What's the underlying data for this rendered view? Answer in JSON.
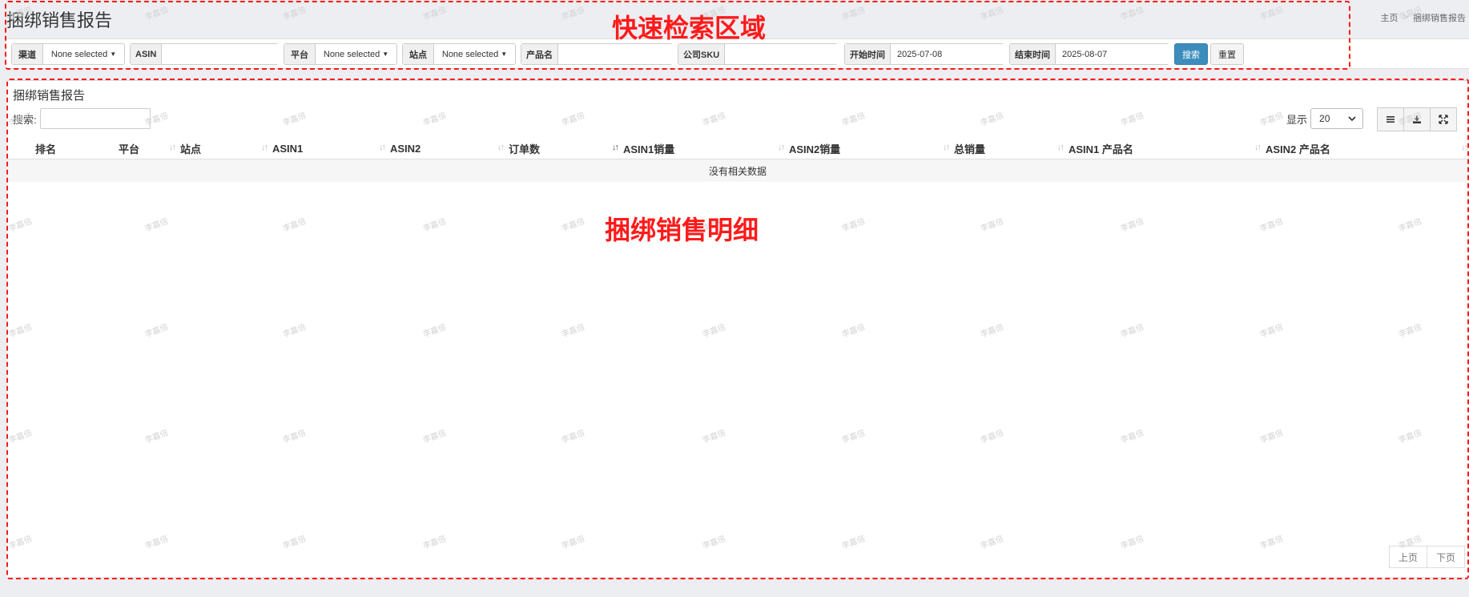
{
  "header": {
    "page_title": "捆绑销售报告",
    "breadcrumb": [
      "主页",
      "捆绑销售报告"
    ],
    "breadcrumb_sep": ">"
  },
  "filters": {
    "channel": {
      "label": "渠道",
      "value": "None selected"
    },
    "asin": {
      "label": "ASIN",
      "value": ""
    },
    "platform": {
      "label": "平台",
      "value": "None selected"
    },
    "site": {
      "label": "站点",
      "value": "None selected"
    },
    "product_name": {
      "label": "产品名",
      "value": ""
    },
    "company_sku": {
      "label": "公司SKU",
      "value": ""
    },
    "start_date": {
      "label": "开始时间",
      "value": "2025-07-08"
    },
    "end_date": {
      "label": "结束时间",
      "value": "2025-08-07"
    },
    "search_button": "搜索",
    "reset_button": "重置"
  },
  "report": {
    "title": "捆绑销售报告",
    "search_label": "搜索:",
    "search_value": "",
    "show_label": "显示",
    "page_size": "20",
    "columns": [
      "排名",
      "平台",
      "站点",
      "ASIN1",
      "ASIN2",
      "订单数",
      "ASIN1销量",
      "ASIN2销量",
      "总销量",
      "ASIN1 产品名",
      "ASIN2 产品名"
    ],
    "empty_text": "没有相关数据",
    "pager": {
      "prev": "上页",
      "next": "下页"
    }
  },
  "annotations": {
    "quick_search": "快速检索区域",
    "detail": "捆绑销售明细"
  },
  "watermark": "李嘉倍",
  "colors": {
    "primary": "#3c8dbc",
    "annotation": "#ff1a1a",
    "page_bg": "#eceef2"
  }
}
